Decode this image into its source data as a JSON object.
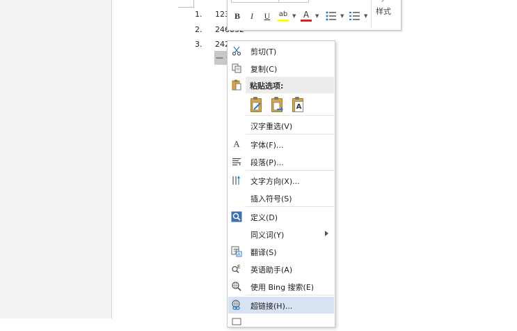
{
  "document": {
    "list": [
      {
        "num": "1.",
        "text": "123"
      },
      {
        "num": "2.",
        "text": "246832"
      },
      {
        "num": "3.",
        "text": "242"
      }
    ],
    "selected_fragment": "— ·"
  },
  "mini_toolbar": {
    "bold": "B",
    "italic": "I",
    "underline": "U",
    "highlight": "ab",
    "font_color": "A",
    "styles_label": "样式",
    "accent_color": "#2b7cd3",
    "highlight_color": "#ffff00",
    "font_color_bar": "#e02020"
  },
  "context_menu": {
    "cut": "剪切(T)",
    "copy": "复制(C)",
    "paste_options": "粘贴选项:",
    "paste_items": [
      "keep-source-formatting",
      "merge-formatting",
      "keep-text-only"
    ],
    "reselect": "汉字重选(V)",
    "font": "字体(F)...",
    "paragraph": "段落(P)...",
    "text_direction": "文字方向(X)...",
    "insert_symbol": "插入符号(S)",
    "define": "定义(D)",
    "synonyms": "同义词(Y)",
    "translate": "翻译(S)",
    "english_assistant": "英语助手(A)",
    "bing_search": "使用 Bing 搜索(E)",
    "hyperlink": "超链接(H)...",
    "hover_color": "#d7e2f2"
  }
}
